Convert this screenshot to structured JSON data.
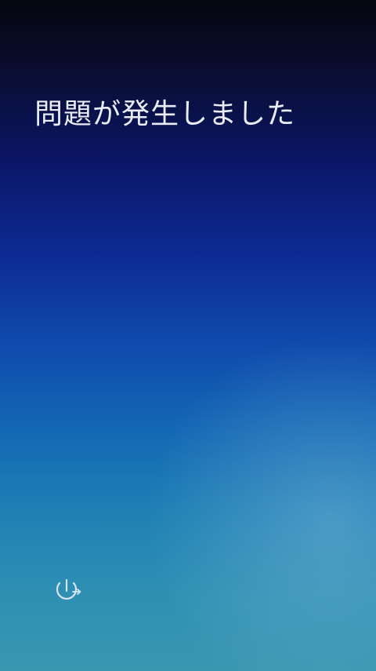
{
  "error_screen": {
    "title": "問題が発生しました"
  },
  "power_button": {
    "icon": "power-options-icon",
    "icon_color": "#d8e4ee"
  },
  "colors": {
    "top": "#05060f",
    "middle": "#0d2b93",
    "bottom": "#3a97b0",
    "text": "#e9ecf4"
  }
}
